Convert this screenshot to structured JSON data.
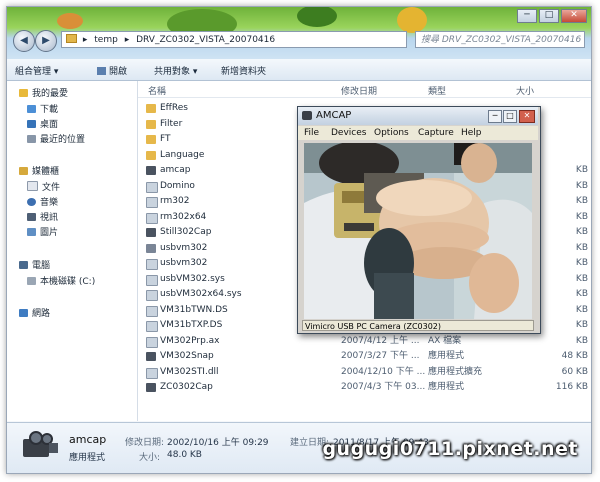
{
  "window": {
    "nav_back": "◀",
    "nav_forward": "▶",
    "caption_minimize": "─",
    "caption_maximize": "□",
    "caption_close": "✕"
  },
  "address": {
    "path": [
      "temp",
      "DRV_ZC0302_VISTA_20070416"
    ]
  },
  "search": {
    "placeholder": "搜尋 DRV_ZC0302_VISTA_20070416"
  },
  "toolbar": {
    "organize": "組合管理 ▾",
    "open": "開啟",
    "share": "共用對象 ▾",
    "new_folder": "新增資料夾"
  },
  "sidebar": {
    "favorites": "我的最愛",
    "downloads": "下載",
    "desktop": "桌面",
    "recent": "最近的位置",
    "libraries": "媒體櫃",
    "documents": "文件",
    "music": "音樂",
    "videos": "視訊",
    "pictures": "圖片",
    "computer": "電腦",
    "local_disk": "本機磁碟 (C:)",
    "network": "網路"
  },
  "columns": {
    "name": "名稱",
    "date": "修改日期",
    "type": "類型",
    "size": "大小"
  },
  "files": [
    {
      "name": "EffRes",
      "date": "",
      "type": "",
      "size": "",
      "kind": "folder"
    },
    {
      "name": "Filter",
      "date": "",
      "type": "",
      "size": "",
      "kind": "folder"
    },
    {
      "name": "FT",
      "date": "",
      "type": "",
      "size": "",
      "kind": "folder"
    },
    {
      "name": "Language",
      "date": "",
      "type": "",
      "size": "",
      "kind": "folder"
    },
    {
      "name": "amcap",
      "date": "",
      "type": "",
      "size": "KB",
      "kind": "app"
    },
    {
      "name": "Domino",
      "date": "",
      "type": "",
      "size": "KB",
      "kind": "file"
    },
    {
      "name": "rm302",
      "date": "",
      "type": "",
      "size": "KB",
      "kind": "file"
    },
    {
      "name": "rm302x64",
      "date": "",
      "type": "",
      "size": "KB",
      "kind": "file"
    },
    {
      "name": "Still302Cap",
      "date": "",
      "type": "",
      "size": "KB",
      "kind": "app"
    },
    {
      "name": "usbvm302",
      "date": "",
      "type": "",
      "size": "KB",
      "kind": "gear"
    },
    {
      "name": "usbvm302",
      "date": "",
      "type": "",
      "size": "KB",
      "kind": "file"
    },
    {
      "name": "usbVM302.sys",
      "date": "",
      "type": "",
      "size": "KB",
      "kind": "file"
    },
    {
      "name": "usbVM302x64.sys",
      "date": "",
      "type": "",
      "size": "KB",
      "kind": "file"
    },
    {
      "name": "VM31bTWN.DS",
      "date": "",
      "type": "",
      "size": "KB",
      "kind": "file"
    },
    {
      "name": "VM31bTXP.DS",
      "date": "",
      "type": "",
      "size": "KB",
      "kind": "file"
    },
    {
      "name": "VM302Prp.ax",
      "date": "2007/4/12 上午 ...",
      "type": "AX 檔案",
      "size": "KB",
      "kind": "file"
    },
    {
      "name": "VM302Snap",
      "date": "2007/3/27 下午 ...",
      "type": "應用程式",
      "size": "48 KB",
      "kind": "app"
    },
    {
      "name": "VM302STI.dll",
      "date": "2004/12/10 下午 ...",
      "type": "應用程式擴充",
      "size": "60 KB",
      "kind": "file"
    },
    {
      "name": "ZC0302Cap",
      "date": "2007/4/3 下午 03...",
      "type": "應用程式",
      "size": "116 KB",
      "kind": "app"
    }
  ],
  "details": {
    "name": "amcap",
    "type": "應用程式",
    "modified_label": "修改日期:",
    "modified": "2002/10/16 上午 09:29",
    "created_label": "建立日期:",
    "created": "2011/8/17 上午 09:43",
    "size_label": "大小:",
    "size": "48.0 KB"
  },
  "amcap": {
    "title": "AMCAP",
    "menu": [
      "File",
      "Devices",
      "Options",
      "Capture",
      "Help"
    ],
    "status": "Vimicro USB PC Camera (ZC0302)"
  },
  "watermark": "gugugi0711.pixnet.net"
}
